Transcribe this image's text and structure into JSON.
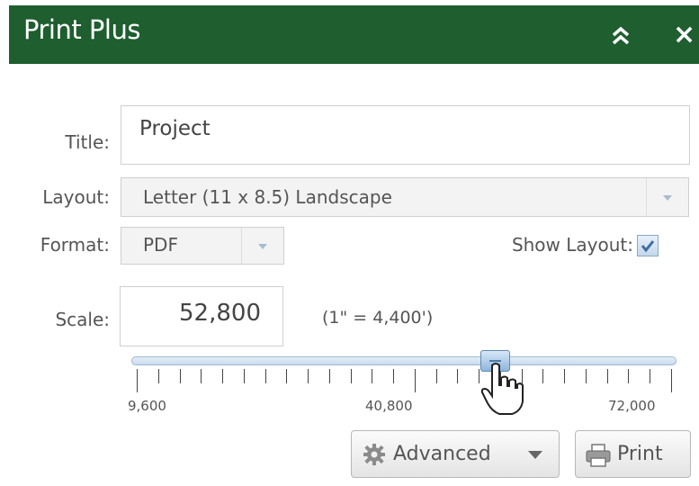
{
  "header": {
    "title": "Print Plus",
    "collapse_icon": "double-chevron-up-icon",
    "close_icon": "close-icon",
    "close_glyph": "×",
    "background_color": "#1e5e2f"
  },
  "form": {
    "title_label": "Title:",
    "title_value": "Project",
    "layout_label": "Layout:",
    "layout_value": "Letter (11 x 8.5) Landscape",
    "format_label": "Format:",
    "format_value": "PDF",
    "show_layout_label": "Show Layout:",
    "show_layout_checked": true,
    "scale_label": "Scale:",
    "scale_value": "52,800",
    "scale_ratio": "(1\" = 4,400')"
  },
  "slider": {
    "min_label": "9,600",
    "mid_label": "40,800",
    "max_label": "72,000",
    "value_fraction": 0.67
  },
  "buttons": {
    "advanced_label": "Advanced",
    "advanced_icon": "gear-icon",
    "print_label": "Print",
    "print_icon": "printer-icon"
  }
}
